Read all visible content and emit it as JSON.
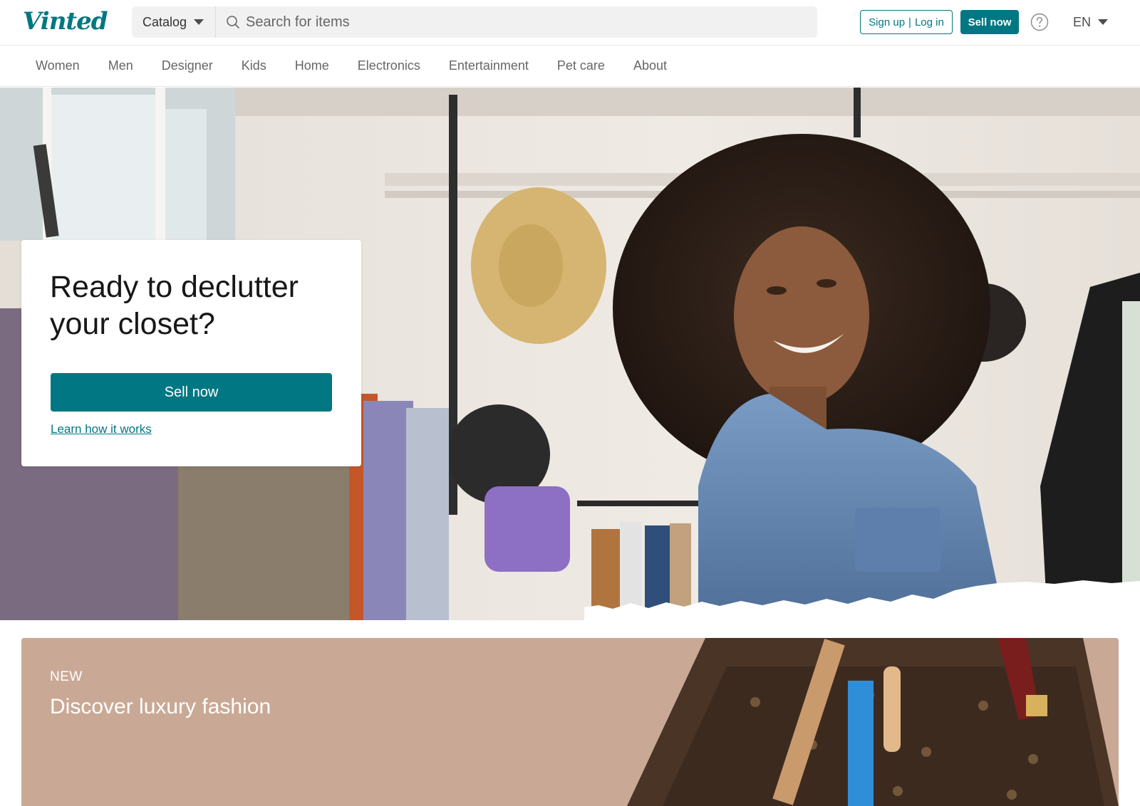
{
  "header": {
    "logo_text": "Vinted",
    "catalog_label": "Catalog",
    "search_placeholder": "Search for items",
    "signup_label": "Sign up",
    "login_label": "Log in",
    "sell_label": "Sell now",
    "language": "EN"
  },
  "nav": {
    "items": [
      "Women",
      "Men",
      "Designer",
      "Kids",
      "Home",
      "Electronics",
      "Entertainment",
      "Pet care",
      "About"
    ]
  },
  "hero": {
    "title": "Ready to declutter your closet?",
    "sell_button": "Sell now",
    "learn_link": "Learn how it works"
  },
  "luxury": {
    "tag": "NEW",
    "title": "Discover luxury fashion"
  },
  "colors": {
    "brand": "#007782",
    "luxury_bg": "#c9a995"
  }
}
